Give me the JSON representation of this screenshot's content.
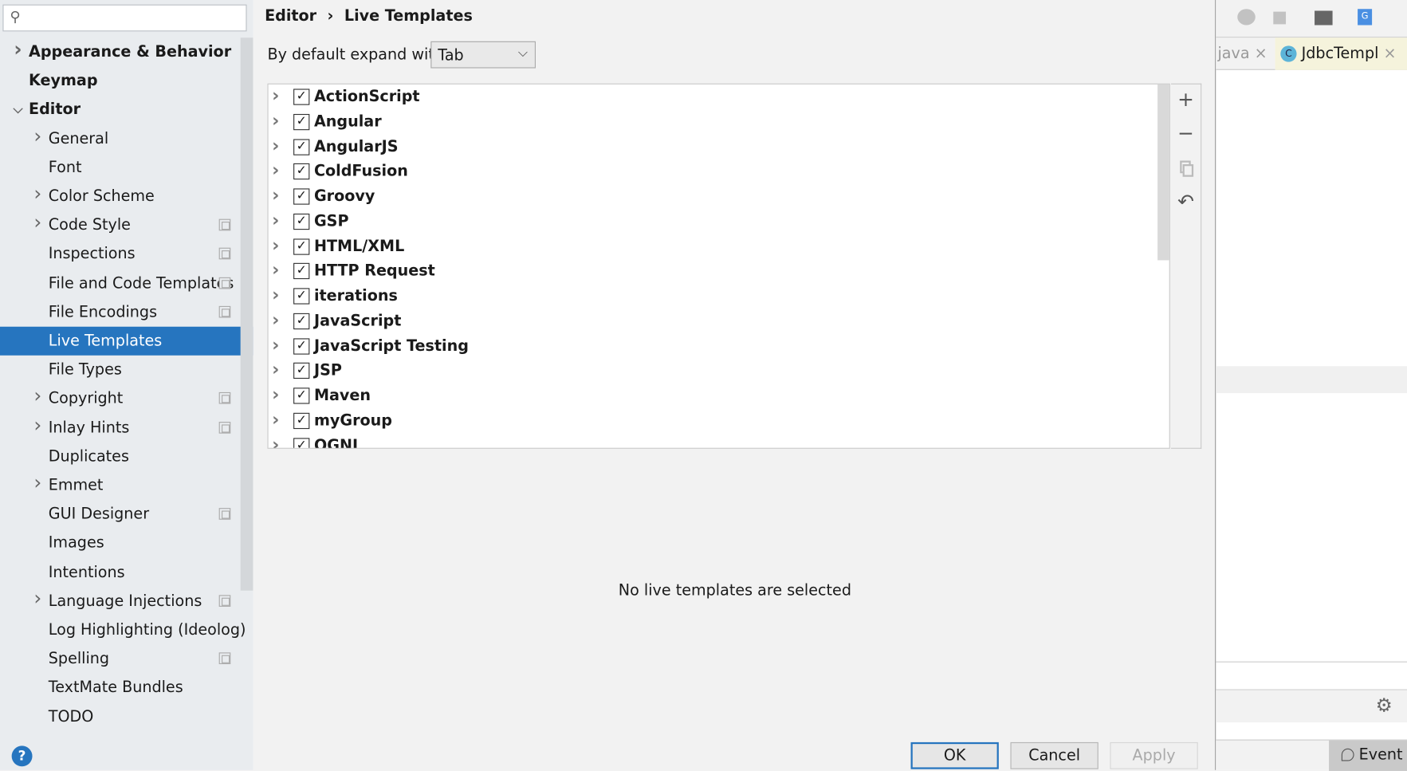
{
  "search": {
    "placeholder": ""
  },
  "sidebar": {
    "items": [
      {
        "label": "Appearance & Behavior",
        "bold": true,
        "arrow": "right",
        "level": 0
      },
      {
        "label": "Keymap",
        "bold": true,
        "arrow": "",
        "level": 0
      },
      {
        "label": "Editor",
        "bold": true,
        "arrow": "down",
        "level": 0
      },
      {
        "label": "General",
        "arrow": "right",
        "level": 1
      },
      {
        "label": "Font",
        "arrow": "",
        "level": 1
      },
      {
        "label": "Color Scheme",
        "arrow": "right",
        "level": 1
      },
      {
        "label": "Code Style",
        "arrow": "right",
        "level": 1,
        "copy_icon": true
      },
      {
        "label": "Inspections",
        "arrow": "",
        "level": 1,
        "copy_icon": true
      },
      {
        "label": "File and Code Templates",
        "arrow": "",
        "level": 1,
        "copy_icon": true
      },
      {
        "label": "File Encodings",
        "arrow": "",
        "level": 1,
        "copy_icon": true
      },
      {
        "label": "Live Templates",
        "arrow": "",
        "level": 1,
        "selected": true
      },
      {
        "label": "File Types",
        "arrow": "",
        "level": 1
      },
      {
        "label": "Copyright",
        "arrow": "right",
        "level": 1,
        "copy_icon": true
      },
      {
        "label": "Inlay Hints",
        "arrow": "right",
        "level": 1,
        "copy_icon": true
      },
      {
        "label": "Duplicates",
        "arrow": "",
        "level": 1
      },
      {
        "label": "Emmet",
        "arrow": "right",
        "level": 1
      },
      {
        "label": "GUI Designer",
        "arrow": "",
        "level": 1,
        "copy_icon": true
      },
      {
        "label": "Images",
        "arrow": "",
        "level": 1
      },
      {
        "label": "Intentions",
        "arrow": "",
        "level": 1
      },
      {
        "label": "Language Injections",
        "arrow": "right",
        "level": 1,
        "copy_icon": true
      },
      {
        "label": "Log Highlighting (Ideolog)",
        "arrow": "",
        "level": 1
      },
      {
        "label": "Spelling",
        "arrow": "",
        "level": 1,
        "copy_icon": true
      },
      {
        "label": "TextMate Bundles",
        "arrow": "",
        "level": 1
      },
      {
        "label": "TODO",
        "arrow": "",
        "level": 1
      }
    ]
  },
  "breadcrumb": {
    "parent": "Editor",
    "separator": "›",
    "current": "Live Templates"
  },
  "expand": {
    "label": "By default expand with",
    "value": "Tab"
  },
  "templates": [
    {
      "label": "ActionScript",
      "checked": true
    },
    {
      "label": "Angular",
      "checked": true
    },
    {
      "label": "AngularJS",
      "checked": true
    },
    {
      "label": "ColdFusion",
      "checked": true
    },
    {
      "label": "Groovy",
      "checked": true
    },
    {
      "label": "GSP",
      "checked": true
    },
    {
      "label": "HTML/XML",
      "checked": true
    },
    {
      "label": "HTTP Request",
      "checked": true
    },
    {
      "label": "iterations",
      "checked": true
    },
    {
      "label": "JavaScript",
      "checked": true
    },
    {
      "label": "JavaScript Testing",
      "checked": true
    },
    {
      "label": "JSP",
      "checked": true
    },
    {
      "label": "Maven",
      "checked": true
    },
    {
      "label": "myGroup",
      "checked": true
    },
    {
      "label": "OGNL",
      "checked": true
    }
  ],
  "toolbar": {
    "add": "+",
    "remove": "−",
    "copy": "copy-icon",
    "revert": "↶"
  },
  "empty_message": "No live templates are selected",
  "buttons": {
    "ok": "OK",
    "cancel": "Cancel",
    "apply": "Apply",
    "help": "?"
  },
  "ide": {
    "tabs": [
      {
        "label": "java"
      },
      {
        "label": "JdbcTempl"
      }
    ],
    "event_log": "Event L"
  },
  "colors": {
    "selection": "#2675bf",
    "accent": "#2675bf"
  }
}
